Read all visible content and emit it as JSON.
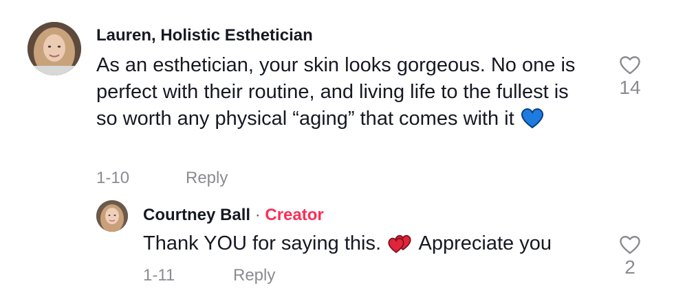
{
  "comment": {
    "author": "Lauren, Holistic Esthetician",
    "text": "As an esthetician, your skin looks gorgeous. No one is perfect with their routine, and living life to the fullest is so worth any physical “aging” that comes with it",
    "date": "1-10",
    "reply_label": "Reply",
    "like_count": "14",
    "emoji": "blue-heart-emoji"
  },
  "reply": {
    "author": "Courtney Ball",
    "separator": "·",
    "badge": "Creator",
    "text_before": "Thank YOU for saying this.",
    "text_after": "Appreciate you",
    "date": "1-11",
    "reply_label": "Reply",
    "like_count": "2",
    "emoji": "two-hearts-emoji"
  },
  "colors": {
    "text": "#161823",
    "meta": "#8a8b91",
    "creator_badge": "#fe2c55",
    "blue_heart": "#1e7be0",
    "red_heart": "#e0243a"
  }
}
